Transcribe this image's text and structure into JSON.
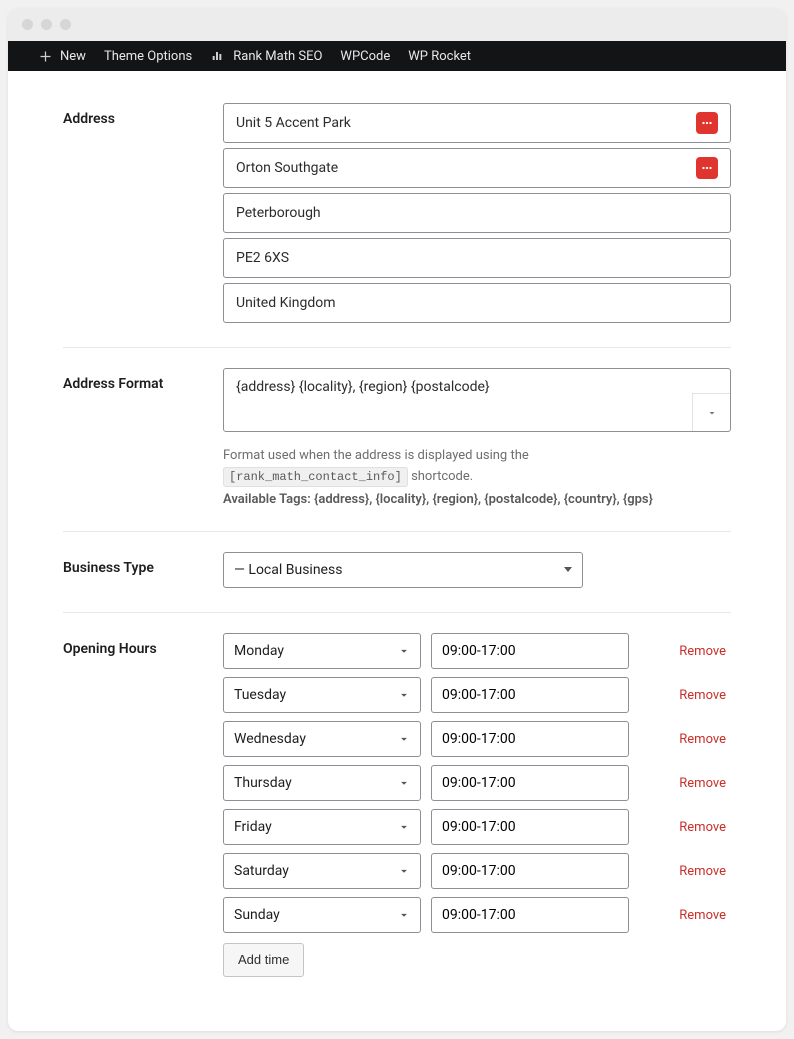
{
  "admin_bar": {
    "new_label": "New",
    "theme_options_label": "Theme Options",
    "rank_math_label": "Rank Math SEO",
    "wpcode_label": "WPCode",
    "wprocket_label": "WP Rocket"
  },
  "address": {
    "label": "Address",
    "lines": [
      "Unit 5 Accent Park",
      "Orton Southgate",
      "Peterborough",
      "PE2 6XS",
      "United Kingdom"
    ]
  },
  "address_format": {
    "label": "Address Format",
    "value": "{address} {locality}, {region} {postalcode}",
    "help_prefix": "Format used when the address is displayed using the",
    "help_code": "[rank_math_contact_info]",
    "help_suffix": "shortcode.",
    "tags_label": "Available Tags:",
    "tags_list": "{address}, {locality}, {region}, {postalcode}, {country}, {gps}"
  },
  "business_type": {
    "label": "Business Type",
    "value": "— Local Business"
  },
  "opening_hours": {
    "label": "Opening Hours",
    "entries": [
      {
        "day": "Monday",
        "time": "09:00-17:00",
        "remove": "Remove"
      },
      {
        "day": "Tuesday",
        "time": "09:00-17:00",
        "remove": "Remove"
      },
      {
        "day": "Wednesday",
        "time": "09:00-17:00",
        "remove": "Remove"
      },
      {
        "day": "Thursday",
        "time": "09:00-17:00",
        "remove": "Remove"
      },
      {
        "day": "Friday",
        "time": "09:00-17:00",
        "remove": "Remove"
      },
      {
        "day": "Saturday",
        "time": "09:00-17:00",
        "remove": "Remove"
      },
      {
        "day": "Sunday",
        "time": "09:00-17:00",
        "remove": "Remove"
      }
    ],
    "add_time_label": "Add time"
  }
}
